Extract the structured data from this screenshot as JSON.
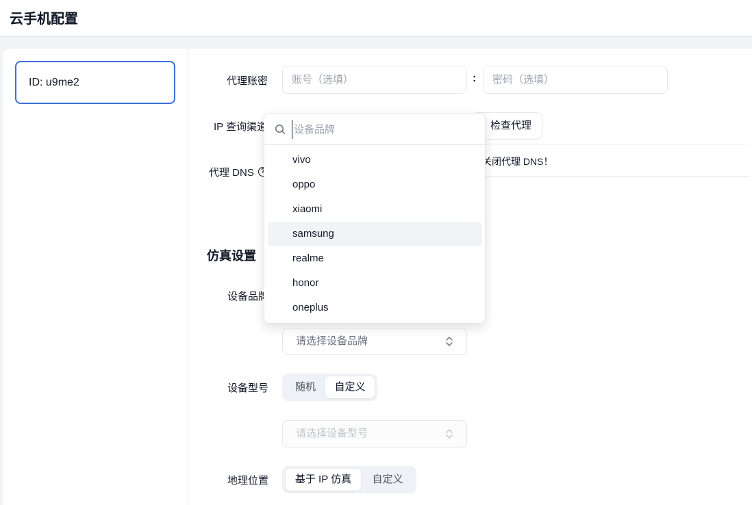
{
  "header": {
    "title": "云手机配置"
  },
  "sidebar": {
    "device_id": "ID: u9me2"
  },
  "proxy": {
    "account_label": "代理账密",
    "account_placeholder": "账号（选填）",
    "colon": ":",
    "password_placeholder": "密码（选填）",
    "ip_channel_label": "IP 查询渠道",
    "check_proxy_button": "检查代理",
    "dns_label": "代理 DNS",
    "dns_help_icon": "?",
    "dns_warning": "关闭代理 DNS！"
  },
  "simulation": {
    "section_title": "仿真设置",
    "brand_label": "设备品牌",
    "brand_select_placeholder": "请选择设备品牌",
    "model_label": "设备型号",
    "model_options": [
      "随机",
      "自定义"
    ],
    "model_selected": "自定义",
    "model_select_placeholder": "请选择设备型号",
    "geo_label": "地理位置",
    "geo_options": [
      "基于 IP 仿真",
      "自定义"
    ],
    "geo_selected": "基于 IP 仿真"
  },
  "brand_dropdown": {
    "search_placeholder": "设备品牌",
    "options": [
      "vivo",
      "oppo",
      "xiaomi",
      "samsung",
      "realme",
      "honor",
      "oneplus"
    ],
    "hovered": "samsung"
  },
  "colors": {
    "accent": "#3b6fd8",
    "border": "#e5e7eb",
    "segment_bg": "#eef1f6",
    "hover_bg": "#f1f3f7"
  }
}
